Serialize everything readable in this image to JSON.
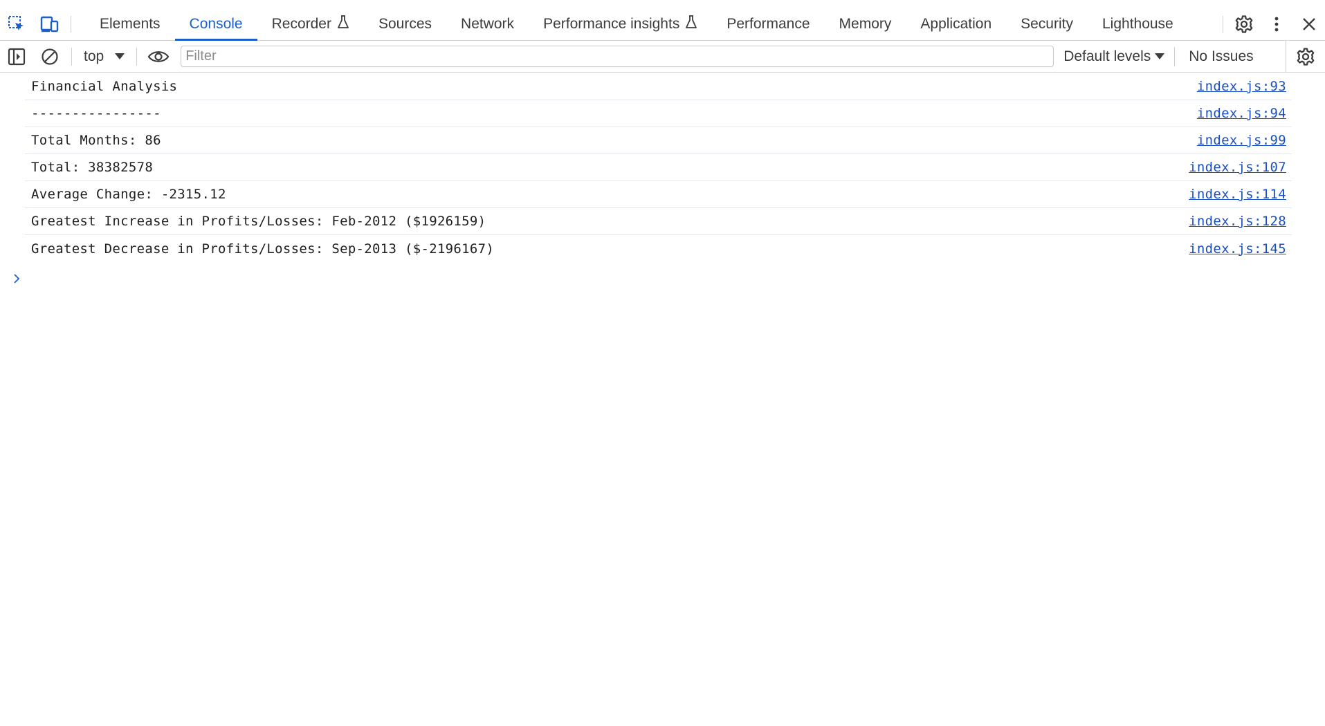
{
  "tabs": [
    {
      "label": "Elements",
      "experimental": false,
      "active": false
    },
    {
      "label": "Console",
      "experimental": false,
      "active": true
    },
    {
      "label": "Recorder",
      "experimental": true,
      "active": false
    },
    {
      "label": "Sources",
      "experimental": false,
      "active": false
    },
    {
      "label": "Network",
      "experimental": false,
      "active": false
    },
    {
      "label": "Performance insights",
      "experimental": true,
      "active": false
    },
    {
      "label": "Performance",
      "experimental": false,
      "active": false
    },
    {
      "label": "Memory",
      "experimental": false,
      "active": false
    },
    {
      "label": "Application",
      "experimental": false,
      "active": false
    },
    {
      "label": "Security",
      "experimental": false,
      "active": false
    },
    {
      "label": "Lighthouse",
      "experimental": false,
      "active": false
    }
  ],
  "toolbar": {
    "context": "top",
    "filter_placeholder": "Filter",
    "filter_value": "",
    "levels": "Default levels",
    "issues": "No Issues"
  },
  "messages": [
    {
      "text": "Financial Analysis",
      "source": "index.js:93"
    },
    {
      "text": "----------------",
      "source": "index.js:94"
    },
    {
      "text": "Total Months: 86",
      "source": "index.js:99"
    },
    {
      "text": "Total: 38382578",
      "source": "index.js:107"
    },
    {
      "text": "Average Change: -2315.12",
      "source": "index.js:114"
    },
    {
      "text": "Greatest Increase in Profits/Losses: Feb-2012 ($1926159)",
      "source": "index.js:128"
    },
    {
      "text": "Greatest Decrease in Profits/Losses: Sep-2013 ($-2196167)",
      "source": "index.js:145"
    }
  ],
  "colors": {
    "accent": "#1a5fc9",
    "link": "#1a4fc4",
    "text": "#1f1f1f",
    "divider": "#d3d3d3"
  },
  "icons": {
    "inspect": "inspect-element-icon",
    "device": "device-toolbar-icon",
    "settings": "gear-icon",
    "more": "more-vertical-icon",
    "close": "close-icon",
    "sidebar": "sidebar-toggle-icon",
    "clear": "clear-console-icon",
    "eye": "live-expression-icon",
    "prompt": "chevron-right-icon",
    "flask": "experimental-flask-icon"
  }
}
